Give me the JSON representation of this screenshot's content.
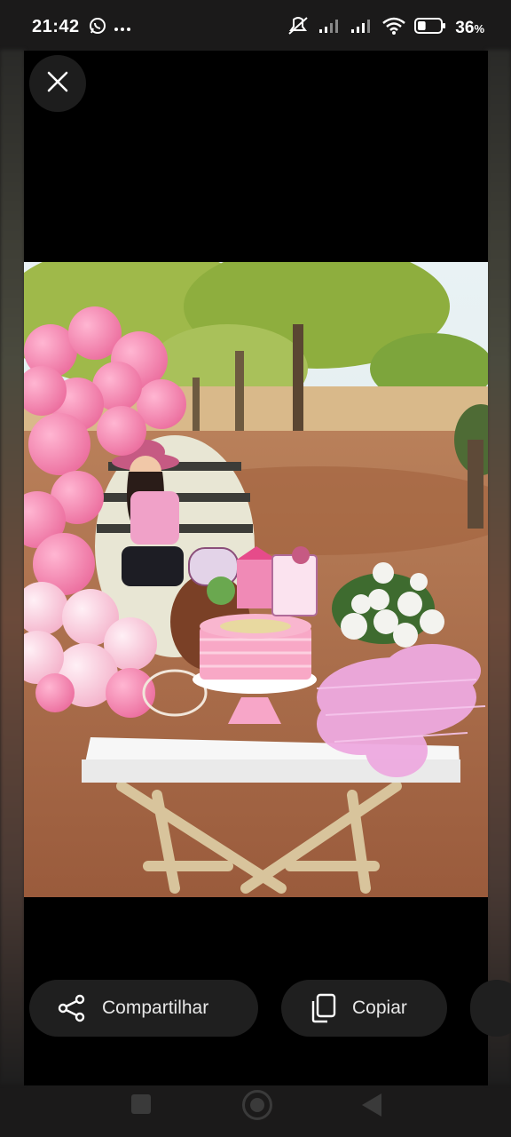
{
  "status_bar": {
    "time": "21:42",
    "battery_percent": "36",
    "battery_unit": "%",
    "battery_level": 0.36,
    "icons": [
      "whatsapp-icon",
      "more-dots-icon",
      "muted-icon",
      "signal-icon",
      "signal-icon",
      "wifi-icon",
      "battery-icon"
    ]
  },
  "viewer": {
    "close_icon": "close-icon"
  },
  "actions": {
    "share_label": "Compartilhar",
    "copy_label": "Copiar",
    "share_icon": "share-icon",
    "copy_icon": "copy-icon"
  },
  "nav": {
    "buttons": [
      "recents-button",
      "home-button",
      "back-button"
    ]
  },
  "colors": {
    "accent_pink": "#f28bb8",
    "pill_bg": "#1f1f1f",
    "background": "#1b1a1a"
  }
}
